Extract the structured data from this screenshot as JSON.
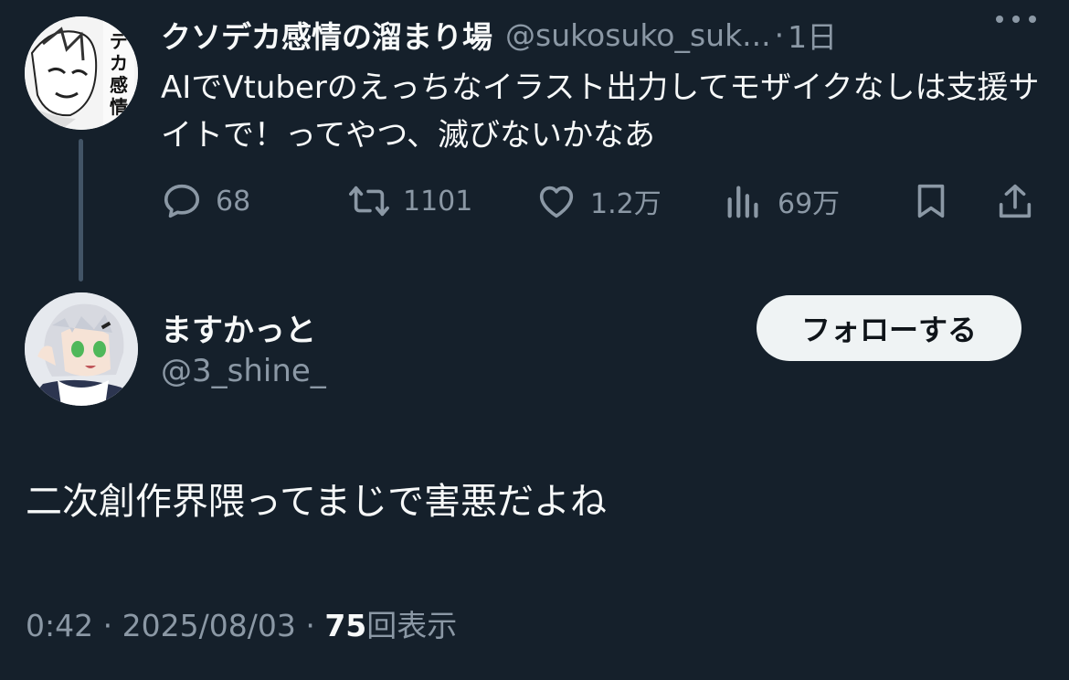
{
  "parent_tweet": {
    "author_name": "クソデカ感情の溜まり場",
    "author_handle": "@sukosuko_suk...",
    "separator": "·",
    "time": "1日",
    "text": "AIでVtuberのえっちなイラスト出力してモザイクなしは支援サイトで！ってやつ、滅びないかなあ",
    "avatar_icon": "manga-avatar-icon",
    "actions": {
      "replies": "68",
      "retweets": "1101",
      "likes": "1.2万",
      "views": "69万"
    }
  },
  "reply_tweet": {
    "author_name": "ますかっと",
    "author_handle": "@3_shine_",
    "follow_label": "フォローする",
    "text": "二次創作界隈ってまじで害悪だよね",
    "avatar_icon": "anime-avatar-icon",
    "meta": {
      "time": "0:42",
      "sep1": "·",
      "date": "2025/08/03",
      "sep2": "·",
      "views_count": "75",
      "views_label": "回表示"
    }
  },
  "colors": {
    "background": "#15202b",
    "primary_text": "#f7f9f9",
    "secondary_text": "#8b98a5",
    "follow_button_bg": "#eff3f4"
  }
}
